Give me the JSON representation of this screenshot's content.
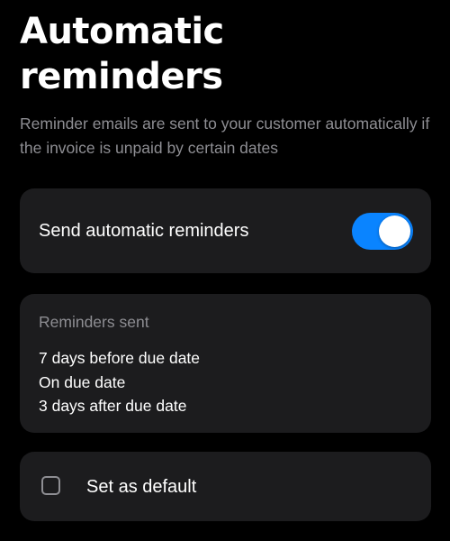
{
  "header": {
    "title": "Automatic reminders",
    "subtitle": "Reminder emails are sent to your customer automatically if the invoice is unpaid by certain dates"
  },
  "auto_reminders": {
    "label": "Send automatic reminders",
    "enabled": true,
    "accent_color": "#0a84ff"
  },
  "reminders_sent": {
    "heading": "Reminders sent",
    "items": [
      "7 days before due date",
      "On due date",
      "3 days after due date"
    ]
  },
  "default_setting": {
    "label": "Set as default",
    "checked": false
  }
}
